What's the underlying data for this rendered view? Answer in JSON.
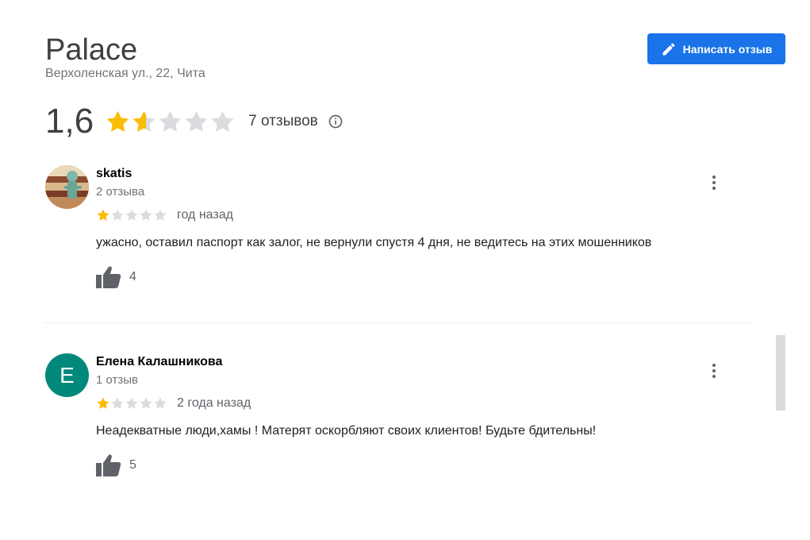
{
  "place": {
    "title": "Palace",
    "address": "Верхоленская ул., 22, Чита"
  },
  "write_button": {
    "label": "Написать отзыв",
    "icon": "pencil-icon"
  },
  "summary": {
    "rating": "1,6",
    "rating_value": 1.6,
    "stars_max": 5,
    "count_label": "7 отзывов",
    "info_icon": "info-icon"
  },
  "reviews": [
    {
      "name": "skatis",
      "reviews_count": "2 отзыва",
      "rating": 1,
      "date": "год назад",
      "text": "ужасно, оставил паспорт как залог, не вернули спустя 4 дня, не ведитесь на этих мошенников",
      "likes": "4",
      "avatar": "photo"
    },
    {
      "name": "Елена Калашникова",
      "reviews_count": "1 отзыв",
      "rating": 1,
      "date": "2 года назад",
      "text": "Неадекватные люди,хамы ! Матерят оскорбляют своих клиентов! Будьте бдительны!",
      "likes": "5",
      "avatar": "E"
    }
  ],
  "colors": {
    "accent": "#1a73e8",
    "star": "#fbbc04",
    "star_empty": "#dadce0",
    "avatar_teal": "#00897b"
  }
}
